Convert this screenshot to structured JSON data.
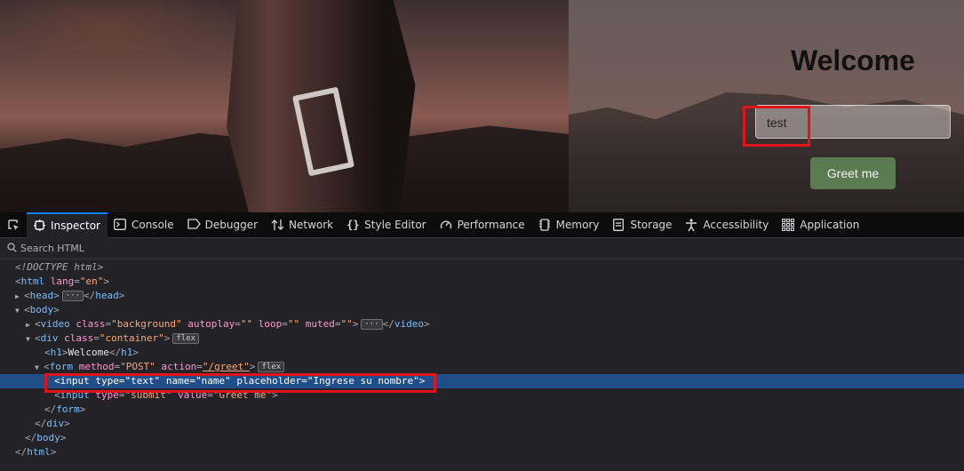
{
  "page": {
    "title": "Welcome",
    "input_value": "test",
    "button_label": "Greet me"
  },
  "devtools": {
    "tabs": [
      {
        "label": "Inspector",
        "icon": "inspector-icon"
      },
      {
        "label": "Console",
        "icon": "console-icon"
      },
      {
        "label": "Debugger",
        "icon": "debugger-icon"
      },
      {
        "label": "Network",
        "icon": "network-icon"
      },
      {
        "label": "Style Editor",
        "icon": "style-editor-icon"
      },
      {
        "label": "Performance",
        "icon": "performance-icon"
      },
      {
        "label": "Memory",
        "icon": "memory-icon"
      },
      {
        "label": "Storage",
        "icon": "storage-icon"
      },
      {
        "label": "Accessibility",
        "icon": "accessibility-icon"
      },
      {
        "label": "Application",
        "icon": "application-icon"
      }
    ],
    "search_placeholder": "Search HTML",
    "tree": {
      "doctype": "<!DOCTYPE html>",
      "html_open_tag": "html",
      "html_lang_attr": "lang",
      "html_lang_val": "\"en\"",
      "head_tag": "head",
      "body_tag": "body",
      "video_tag": "video",
      "video_class_attr": "class",
      "video_class_val": "\"background\"",
      "video_autoplay_attr": "autoplay",
      "video_autoplay_val": "\"\"",
      "video_loop_attr": "loop",
      "video_loop_val": "\"\"",
      "video_muted_attr": "muted",
      "video_muted_val": "\"\"",
      "div_tag": "div",
      "div_class_attr": "class",
      "div_class_val": "\"container\"",
      "badge_flex": "flex",
      "h1_tag": "h1",
      "h1_text": "Welcome",
      "form_tag": "form",
      "form_method_attr": "method",
      "form_method_val": "\"POST\"",
      "form_action_attr": "action",
      "form_action_val": "\"/greet\"",
      "input_tag": "input",
      "input_type_attr": "type",
      "input_type_val": "\"text\"",
      "input_name_attr": "name",
      "input_name_val": "\"name\"",
      "input_placeholder_attr": "placeholder",
      "input_placeholder_val": "\"Ingrese su nombre\"",
      "submit_type_val": "\"submit\"",
      "submit_value_attr": "value",
      "submit_value_val": "\"Greet me\""
    }
  },
  "colors": {
    "highlight_red": "#e0131a",
    "selected_row": "#204e8a",
    "button_green": "#5a7a52"
  }
}
